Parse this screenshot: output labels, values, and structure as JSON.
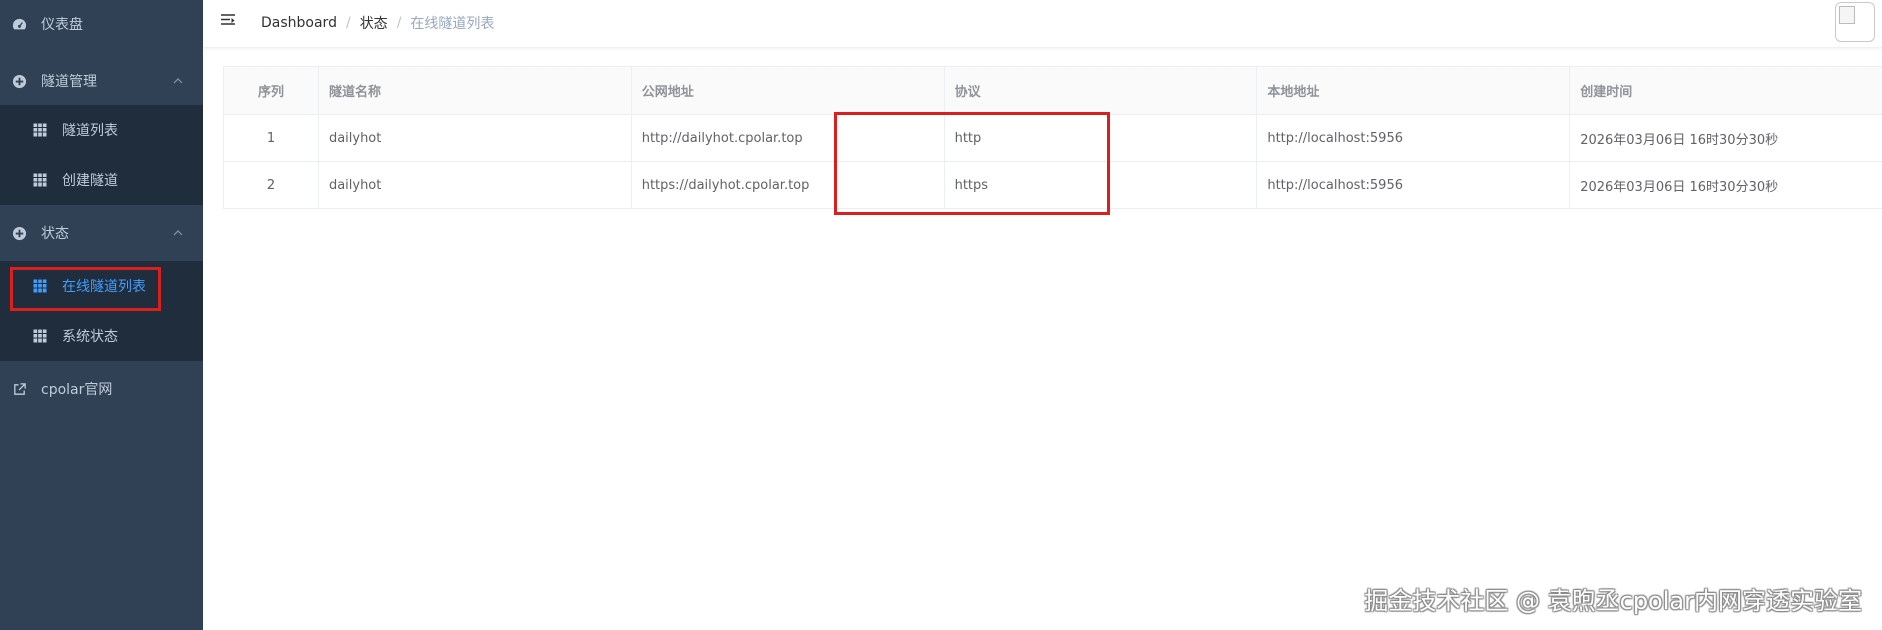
{
  "colors": {
    "sidebar_bg": "#304156",
    "submenu_bg": "#1f2d3d",
    "sidebar_text": "#bfcbd9",
    "active_text": "#409eff",
    "highlight_red": "#d9201f"
  },
  "sidebar": {
    "dashboard": {
      "label": "仪表盘",
      "icon": "dashboard-icon"
    },
    "tunnel_mgmt": {
      "label": "隧道管理",
      "icon": "plus-circle-icon",
      "expanded": true,
      "items": [
        {
          "label": "隧道列表",
          "icon": "table-icon"
        },
        {
          "label": "创建隧道",
          "icon": "table-icon"
        }
      ]
    },
    "status": {
      "label": "状态",
      "icon": "plus-circle-icon",
      "expanded": true,
      "items": [
        {
          "label": "在线隧道列表",
          "icon": "table-icon",
          "active": true
        },
        {
          "label": "系统状态",
          "icon": "table-icon"
        }
      ]
    },
    "website": {
      "label": "cpolar官网",
      "icon": "external-link-icon"
    }
  },
  "header": {
    "breadcrumb": [
      "Dashboard",
      "状态",
      "在线隧道列表"
    ],
    "separator": "/"
  },
  "table": {
    "columns": [
      "序列",
      "隧道名称",
      "公网地址",
      "协议",
      "本地地址",
      "创建时间"
    ],
    "rows": [
      [
        "1",
        "dailyhot",
        "http://dailyhot.cpolar.top",
        "http",
        "http://localhost:5956",
        "2026年03月06日 16时30分30秒"
      ],
      [
        "2",
        "dailyhot",
        "https://dailyhot.cpolar.top",
        "https",
        "http://localhost:5956",
        "2026年03月06日 16时30分30秒"
      ]
    ]
  },
  "watermark": "掘金技术社区 @ 袁煦丞cpolar内网穿透实验室"
}
